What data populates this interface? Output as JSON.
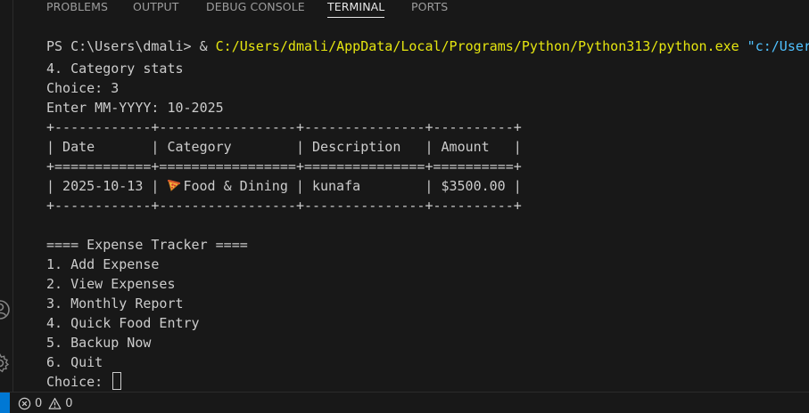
{
  "panel": {
    "tabs": [
      {
        "label": "PROBLEMS",
        "active": false
      },
      {
        "label": "OUTPUT",
        "active": false
      },
      {
        "label": "DEBUG CONSOLE",
        "active": false
      },
      {
        "label": "TERMINAL",
        "active": true
      },
      {
        "label": "PORTS",
        "active": false
      }
    ]
  },
  "terminal": {
    "command": {
      "prompt": "PS C:\\Users\\dmali> ",
      "amp": "& ",
      "exe": "C:/Users/dmali/AppData/Local/Programs/Python/Python313/python.exe",
      "arg": " \"c:/User"
    },
    "lines": {
      "category_stats": "4. Category stats",
      "choice_3": "Choice: 3",
      "enter_month": "Enter MM-YYYY: 10-2025",
      "table_border_top": "+------------+-----------------+---------------+----------+",
      "table_header": "| Date       | Category        | Description   | Amount   |",
      "table_border_header": "+============+=================+===============+==========+",
      "table_row_start": "| 2025-10-13 | ",
      "table_row_category": "Food & Dining",
      "table_row_end": " | kunafa        | $3500.00 |",
      "table_border_bottom": "+------------+-----------------+---------------+----------+",
      "menu_title": "==== Expense Tracker ====",
      "menu_1": "1. Add Expense",
      "menu_2": "2. View Expenses",
      "menu_3": "3. Monthly Report",
      "menu_4": "4. Quick Food Entry",
      "menu_5": "5. Backup Now",
      "menu_6": "6. Quit",
      "choice_prompt": "Choice: "
    },
    "category_icon": "pizza-icon"
  },
  "status_bar": {
    "errors": "0",
    "warnings": "0"
  },
  "colors": {
    "background": "#181818",
    "text": "#cccccc",
    "exe_path": "#e5e510",
    "argument": "#4fc1ff",
    "remote_indicator": "#0078d4"
  }
}
